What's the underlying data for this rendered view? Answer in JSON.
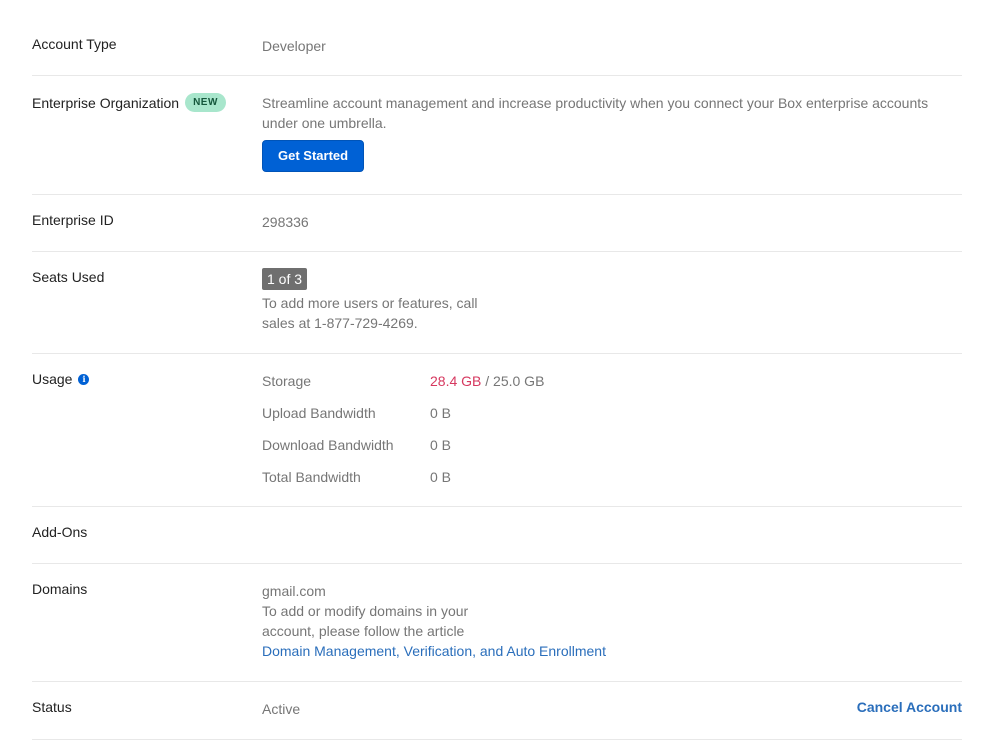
{
  "account_type": {
    "label": "Account Type",
    "value": "Developer"
  },
  "enterprise_org": {
    "label": "Enterprise Organization",
    "badge": "NEW",
    "description_line1": "Streamline account management and increase productivity when you connect your Box enterprise accounts",
    "description_line2": "under one umbrella.",
    "button_label": "Get Started"
  },
  "enterprise_id": {
    "label": "Enterprise ID",
    "value": "298336"
  },
  "seats": {
    "label": "Seats Used",
    "badge": "1 of 3",
    "note_line1": "To add more users or features, call",
    "note_line2": "sales at 1-877-729-4269."
  },
  "usage": {
    "label": "Usage",
    "info_icon": "info-icon",
    "rows": [
      {
        "name": "Storage",
        "used": "28.4 GB",
        "total": " / 25.0 GB"
      },
      {
        "name": "Upload Bandwidth",
        "value": "0 B"
      },
      {
        "name": "Download Bandwidth",
        "value": "0 B"
      },
      {
        "name": "Total Bandwidth",
        "value": "0 B"
      }
    ]
  },
  "addons": {
    "label": "Add-Ons"
  },
  "domains": {
    "label": "Domains",
    "domain": "gmail.com",
    "note_line1": "To add or modify domains in your",
    "note_line2": "account, please follow the article",
    "link_text": "Domain Management, Verification, and Auto Enrollment"
  },
  "status": {
    "label": "Status",
    "value": "Active",
    "cancel_label": "Cancel Account"
  },
  "colors": {
    "primary": "#0061d5",
    "link": "#2a6ebb",
    "over_quota": "#d6385f",
    "new_badge_bg": "#a8e6cc"
  }
}
